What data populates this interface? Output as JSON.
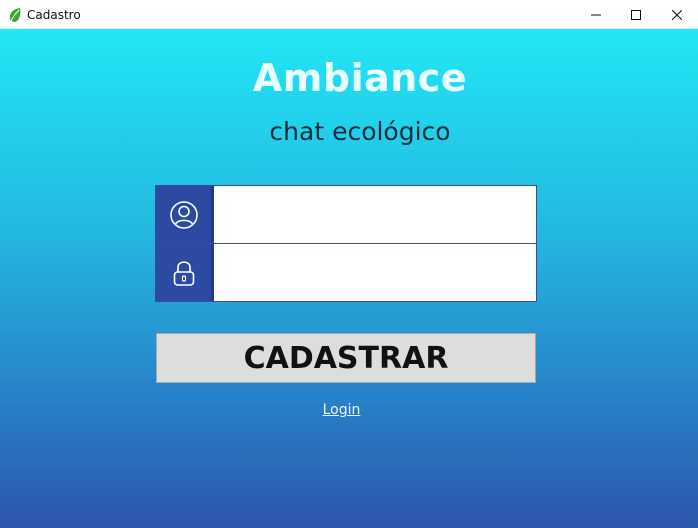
{
  "window": {
    "title": "Cadastro",
    "app_icon": "leaf-icon",
    "controls": [
      "minimize-icon",
      "maximize-icon",
      "close-icon"
    ]
  },
  "header": {
    "brand": "Ambiance",
    "tagline": "chat ecológico"
  },
  "form": {
    "username": {
      "icon": "user-icon",
      "value": "",
      "placeholder": ""
    },
    "password": {
      "icon": "lock-icon",
      "value": "",
      "placeholder": ""
    },
    "submit_label": "CADASTRAR",
    "login_link": "Login"
  },
  "colors": {
    "gradient_top": "#22e6f5",
    "gradient_bottom": "#2c55ab",
    "icon_panel": "#2d4aa3",
    "button_bg": "#dddddd",
    "brand_text": "#e8ffff"
  }
}
